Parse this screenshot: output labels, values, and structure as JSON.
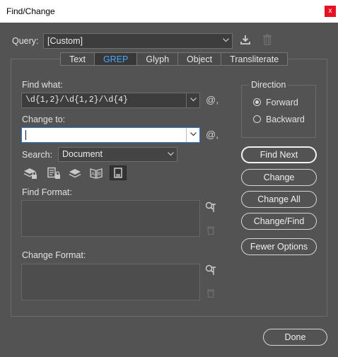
{
  "window": {
    "title": "Find/Change",
    "close_glyph": "x"
  },
  "query": {
    "label": "Query:",
    "value": "[Custom]"
  },
  "tabs": [
    {
      "label": "Text"
    },
    {
      "label": "GREP"
    },
    {
      "label": "Glyph"
    },
    {
      "label": "Object"
    },
    {
      "label": "Transliterate"
    }
  ],
  "find_what": {
    "label": "Find what:",
    "value": "\\d{1,2}/\\d{1,2}/\\d{4}",
    "special_char_glyph": "@,"
  },
  "change_to": {
    "label": "Change to:",
    "value": "",
    "special_char_glyph": "@,"
  },
  "search": {
    "label": "Search:",
    "value": "Document"
  },
  "find_format": {
    "label": "Find Format:"
  },
  "change_format": {
    "label": "Change Format:"
  },
  "direction": {
    "label": "Direction",
    "forward": "Forward",
    "backward": "Backward",
    "selected": "Forward"
  },
  "buttons": {
    "find_next": "Find Next",
    "change": "Change",
    "change_all": "Change All",
    "change_find": "Change/Find",
    "fewer_options": "Fewer Options",
    "done": "Done"
  },
  "colors": {
    "background": "#535353",
    "selected_tab_text": "#4aa6ff",
    "active_border": "#2d7bd6",
    "close": "#e81123"
  }
}
